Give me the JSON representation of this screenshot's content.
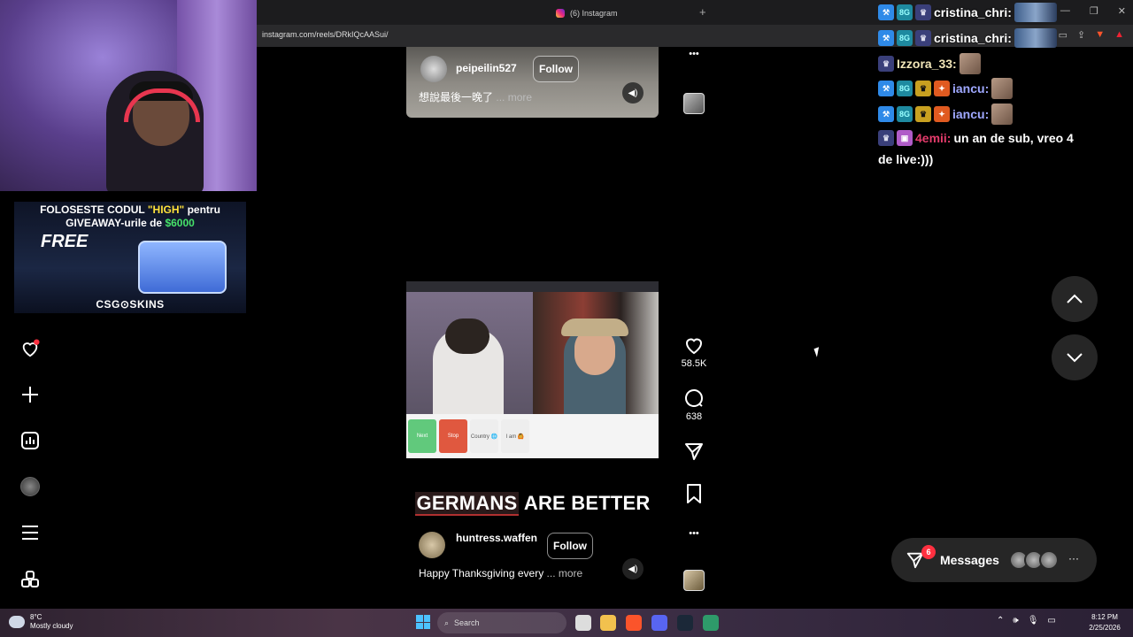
{
  "browser": {
    "tab_title": "(6) Instagram",
    "new_tab_symbol": "+",
    "url": "instagram.com/reels/DRkIQcAASui/"
  },
  "ad": {
    "line1_prefix": "FOLOSESTE CODUL ",
    "line1_code": "\"HIGH\"",
    "line1_suffix": " pentru",
    "line2_prefix": "GIVEAWAY-urile de ",
    "line2_amount": "$6000",
    "free": "FREE",
    "brand": "CSG⊙SKINS"
  },
  "rail": {
    "items": [
      {
        "icon": "heart-icon",
        "has_dot": true
      },
      {
        "icon": "plus-icon"
      },
      {
        "icon": "stats-icon"
      },
      {
        "icon": "profile-avatar"
      },
      {
        "icon": "menu-icon"
      },
      {
        "icon": "apps-icon"
      }
    ]
  },
  "reel_top": {
    "username": "peipeilin527",
    "follow": "Follow",
    "caption": "想說最後一晚了",
    "more": "... more"
  },
  "reel_main": {
    "overlay_highlight": "GERMANS",
    "overlay_rest": " ARE BETTER",
    "username": "huntress.waffen",
    "follow": "Follow",
    "caption": "Happy Thanksgiving every",
    "more": "... more",
    "chips": [
      "Next",
      "Stop",
      "Country 🌐",
      "I am 🙆"
    ]
  },
  "actions": {
    "likes": "58.5K",
    "comments": "638",
    "more_symbol": "•••"
  },
  "messages": {
    "label": "Messages",
    "badge": "6",
    "more_symbol": "···"
  },
  "chat": {
    "lines": [
      {
        "name": "cristina_chri:",
        "color": "#ffffff"
      },
      {
        "name": "cristina_chri:",
        "color": "#ffffff"
      },
      {
        "name": "Izzora_33:",
        "color": "#f2e6b8"
      },
      {
        "name": "iancu:",
        "color": "#9fa8ff"
      },
      {
        "name": "iancu:",
        "color": "#9fa8ff"
      },
      {
        "name": "4emii:",
        "color": "#e33b6b",
        "message": "un an de sub, vreo 4",
        "message2": "de live:)))"
      }
    ]
  },
  "taskbar": {
    "temp": "8°C",
    "weather": "Mostly cloudy",
    "search": "Search",
    "time": "8:12 PM",
    "date": "2/25/2026"
  },
  "colors": {
    "accent_red": "#ff3040",
    "panel": "#262626"
  }
}
